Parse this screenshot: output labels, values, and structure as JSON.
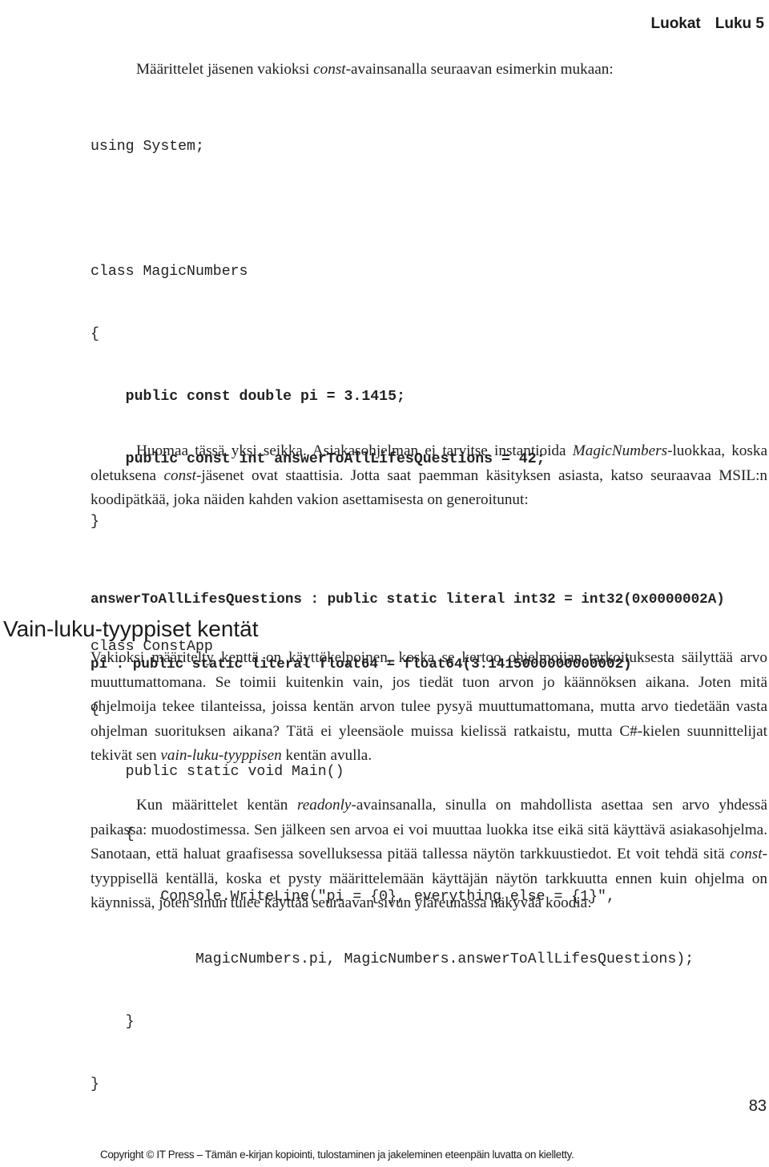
{
  "running_head": {
    "chapter_title": "Luokat",
    "chapter_number": "Luku 5"
  },
  "intro_paragraph": {
    "before": "Määrittelet jäsenen vakioksi ",
    "keyword": "const",
    "after": "-avainsanalla seuraavan esimerkin mukaan:"
  },
  "code_listing": {
    "lines": [
      {
        "text": "using System;",
        "bold": false
      },
      {
        "text": "",
        "bold": false
      },
      {
        "text": "class MagicNumbers",
        "bold": false
      },
      {
        "text": "{",
        "bold": false
      },
      {
        "text": "    public const double pi = 3.1415;",
        "bold": true
      },
      {
        "text": "    public const int answerToAllLifesQuestions = 42;",
        "bold": true
      },
      {
        "text": "}",
        "bold": false
      },
      {
        "text": "",
        "bold": false
      },
      {
        "text": "class ConstApp",
        "bold": false
      },
      {
        "text": "{",
        "bold": false
      },
      {
        "text": "    public static void Main()",
        "bold": false
      },
      {
        "text": "    {",
        "bold": false
      },
      {
        "text": "        Console.WriteLine(\"pi = {0}, everything else = {1}\",",
        "bold": false
      },
      {
        "text": "            MagicNumbers.pi, MagicNumbers.answerToAllLifesQuestions);",
        "bold": false
      },
      {
        "text": "    }",
        "bold": false
      },
      {
        "text": "}",
        "bold": false
      }
    ]
  },
  "note_paragraph": {
    "part1": "Huomaa tässä yksi seikka. Asiakasohjelman ei tarvitse instantioida ",
    "italic1": "MagicNumbers",
    "part2": "-luokkaa, koska oletuksena ",
    "italic2": "const",
    "part3": "-jäsenet ovat staattisia. Jotta saat paemman käsityksen asiasta, katso seuraavaa MSIL:n koodipätkää, joka näiden kahden vakion asettamisesta on generoitunut:"
  },
  "msil_listing": {
    "lines": [
      "answerToAllLifesQuestions : public static literal int32 = int32(0x0000002A)",
      "pi : public static literal float64 = float64(3.1415000000000002)"
    ]
  },
  "section": {
    "heading": "Vain-luku-tyyppiset kentät",
    "paragraph1": {
      "part1": "Vakioksi määritelty kenttä on käyttökelpoinen, koska se kertoo ohjelmoijan tarkoituksesta säilyttää arvo muuttumattomana. Se toimii kuitenkin vain, jos tiedät tuon arvon jo käännöksen aikana. Joten mitä ohjelmoija tekee tilanteissa, joissa kentän arvon tulee pysyä muuttumattomana, mutta arvo tiedetään vasta ohjelman suorituksen aikana? Tätä ei yleensäole muissa kielissä ratkaistu, mutta C#-kielen suunnittelijat tekivät sen ",
      "italic": "vain-luku-tyyppisen",
      "part2": " kentän avulla."
    },
    "paragraph2": {
      "part1": "Kun määrittelet kentän ",
      "italic1": "readonly",
      "part2": "-avainsanalla, sinulla on mahdollista asettaa sen arvo yhdessä paikassa: muodostimessa. Sen jälkeen sen arvoa ei voi muuttaa luokka itse eikä sitä käyttävä asiakasohjelma. Sanotaan, että haluat graafisessa sovelluksessa pitää tallessa näytön tarkkuustiedot. Et voit tehdä sitä ",
      "italic2": "const",
      "part3": "-tyyppisellä kentällä, koska et pysty määrittelemään käyttäjän näytön tarkkuutta ennen kuin ohjelma on käynnissä, joten sinun tulee käyttää seuraavan sivun yläreunassa näkyvää koodia:"
    }
  },
  "page_number": "83",
  "footer": "Copyright © IT Press – Tämän e-kirjan kopiointi, tulostaminen ja jakeleminen eteenpäin luvatta on kielletty."
}
